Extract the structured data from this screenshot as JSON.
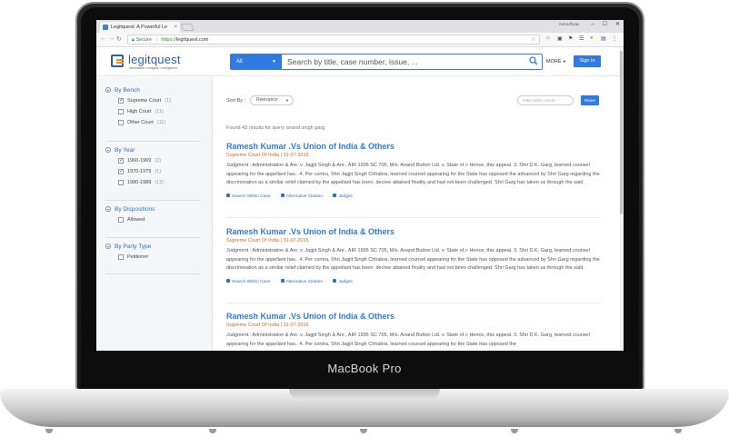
{
  "device": {
    "brand": "MacBook Pro"
  },
  "browser": {
    "tab_title": "Legitquest: A Powerful Le",
    "secure_label": "Secure",
    "url_scheme": "https://",
    "url_host": "legitquest.com",
    "user_label": "Subodhyav"
  },
  "header": {
    "logo": "legitquest",
    "tagline": "information • insights • intelligence",
    "search_category": "All",
    "search_placeholder": "Search by title, case number, issue, ...",
    "more_label": "MORE",
    "signin_label": "Sign In"
  },
  "sidebar": {
    "facets": [
      {
        "title": "By Bench",
        "items": [
          {
            "label": "Supreme Court",
            "count": "(1)",
            "checked": true
          },
          {
            "label": "High Court",
            "count": "(11)",
            "checked": false
          },
          {
            "label": "Other Court",
            "count": "(11)",
            "checked": false
          }
        ]
      },
      {
        "title": "By Year",
        "items": [
          {
            "label": "1960-1969",
            "count": "(2)",
            "checked": true
          },
          {
            "label": "1970-1979",
            "count": "(1)",
            "checked": true
          },
          {
            "label": "1980-1989",
            "count": "(12)",
            "checked": false
          }
        ]
      },
      {
        "title": "By Dispositions",
        "items": [
          {
            "label": "Allowed",
            "count": "",
            "checked": false
          }
        ]
      },
      {
        "title": "By Party Type",
        "items": [
          {
            "label": "Petitioner",
            "count": "",
            "checked": false
          }
        ]
      }
    ]
  },
  "main": {
    "sort_label": "Sort By :",
    "sort_value": "Relevance",
    "filter_placeholder": "Filter within result",
    "reset_label": "Reset",
    "found_text": "Found 43 results for query anand singh garg",
    "results": [
      {
        "title": "Ramesh Kumar .Vs Union of India & Others",
        "court": "Supreme Court Of India | 31-07-2015",
        "snippet": "Judgment : Administration & Anr. v. Jagjit Singh & Anr., AIR 1995 SC 705, M/s. Anand Button Ltd. v. State of.> Hence, this appeal. 3. Shri D.K. Garg, learned counsel appearing for the appellant has.. 4. Per contra, Shri Jagjit Singh Chhabra, learned counsel appearing for the State has opposed the advanced by Shri Garg regarding the discrimination as a similar relief claimed by the appellant has been. decree attained finality and had not been challenged. Shri Garg has taken us through the said.",
        "actions": [
          "Search Within Case",
          "Alternative Citation",
          "Judges"
        ]
      },
      {
        "title": "Ramesh Kumar .Vs Union of India & Others",
        "court": "Supreme Court Of India | 31-07-2015",
        "snippet": "Judgment : Administration & Anr. v. Jagjit Singh & Anr., AIR 1995 SC 705, M/s. Anand Button Ltd. v. State of.> Hence, this appeal. 3. Shri D.K. Garg, learned counsel appearing for the appellant has.. 4. Per contra, Shri Jagjit Singh Chhabra, learned counsel appearing for the State has opposed the advanced by Shri Garg regarding the discrimination as a similar relief claimed by the appellant has been. decree attained finality and had not been challenged. Shri Garg has taken us through the said.",
        "actions": [
          "Search Within Case",
          "Alternative Citation",
          "Judges"
        ]
      },
      {
        "title": "Ramesh Kumar .Vs Union of India & Others",
        "court": "Supreme Court Of India | 31-07-2015",
        "snippet": "Judgment : Administration & Anr. v. Jagjit Singh & Anr., AIR 1995 SC 705, M/s. Anand Button Ltd. v. State of.> Hence, this appeal. 3. Shri D.K. Garg, learned counsel appearing for the appellant has.. 4. Per contra, Shri Jagjit Singh Chhabra, learned counsel appearing for the State has opposed the",
        "actions": []
      }
    ]
  }
}
